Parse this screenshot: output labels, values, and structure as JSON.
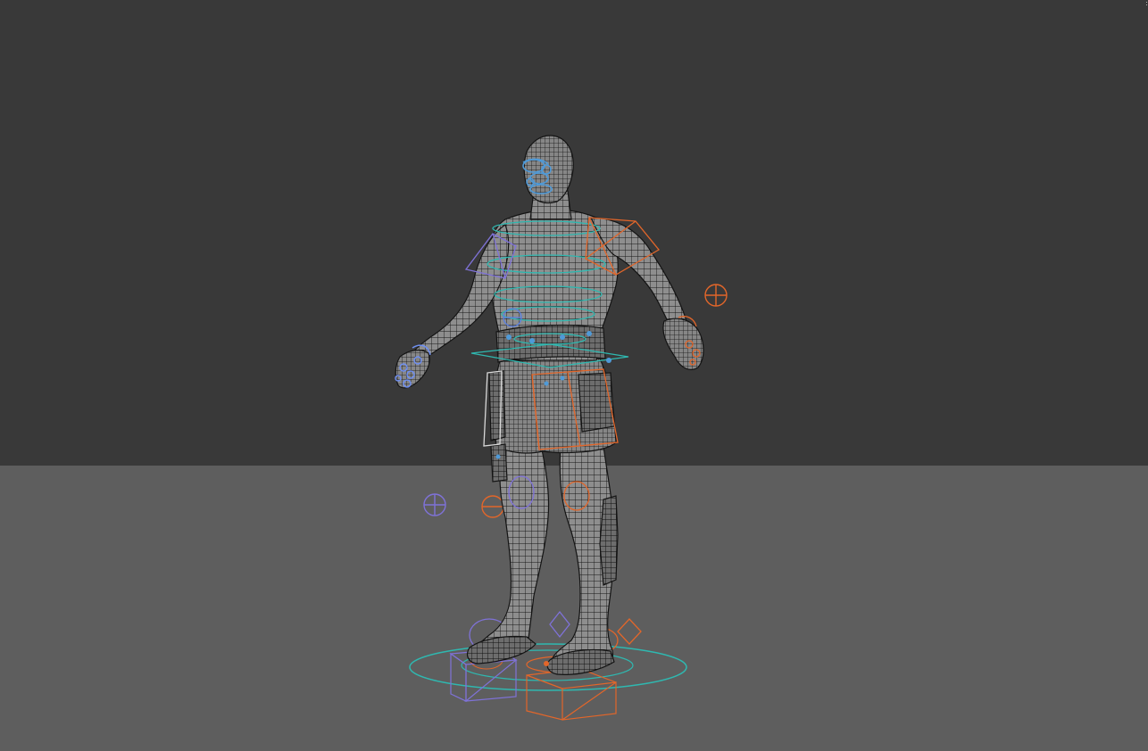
{
  "viewport": {
    "background_wall_color": "#393939",
    "floor_color": "#5e5e5e",
    "mesh_fill_color": "#8b8b8b",
    "wireframe_color": "#161616",
    "rig_colors": {
      "cyan": "#2fb8b0",
      "blue": "#5a7fe0",
      "violet": "#7f72d8",
      "orange": "#e2662a",
      "white": "#d8d8d8"
    },
    "corner_glyph": ":"
  }
}
